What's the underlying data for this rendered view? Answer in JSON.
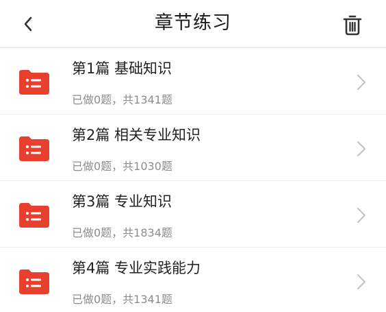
{
  "header": {
    "title": "章节练习",
    "back_icon": "chevron-left-icon",
    "delete_icon": "trash-icon"
  },
  "colors": {
    "accent": "#e8402e",
    "title_text": "#1a1a1a",
    "subtitle_text": "#8c8c8c"
  },
  "chapters": [
    {
      "title": "第1篇 基础知识",
      "progress": "已做0题，共1341题"
    },
    {
      "title": "第2篇 相关专业知识",
      "progress": "已做0题，共1030题"
    },
    {
      "title": "第3篇 专业知识",
      "progress": "已做0题，共1834题"
    },
    {
      "title": "第4篇 专业实践能力",
      "progress": "已做0题，共1341题"
    }
  ]
}
